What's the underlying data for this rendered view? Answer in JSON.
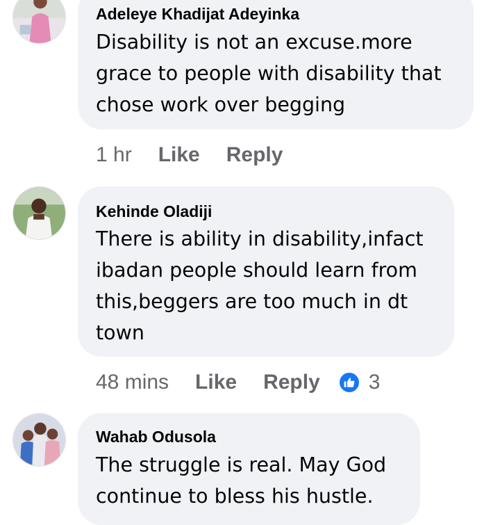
{
  "comments": [
    {
      "author": "Adeleye Khadijat Adeyinka",
      "lines": [
        "Disability is not an excuse.more",
        "grace to people with disability that",
        "chose work over begging"
      ],
      "time": "1 hr",
      "like_label": "Like",
      "reply_label": "Reply",
      "avatar_icon": "user-avatar-icon"
    },
    {
      "author": "Kehinde Oladiji",
      "lines": [
        "There is ability in disability,infact",
        "ibadan people should learn from",
        "this,beggers are too much in dt",
        "town"
      ],
      "time": "48 mins",
      "like_label": "Like",
      "reply_label": "Reply",
      "reaction_icon": "like-icon",
      "reaction_count": "3",
      "avatar_icon": "user-avatar-icon"
    },
    {
      "author": "Wahab Odusola",
      "lines": [
        "The struggle is real. May God",
        "continue to bless his hustle."
      ],
      "avatar_icon": "user-avatar-icon"
    }
  ],
  "colors": {
    "bubble_bg": "#f0f2f5",
    "meta_text": "#65676b",
    "like_blue": "#1877f2",
    "body_text": "#050505"
  }
}
